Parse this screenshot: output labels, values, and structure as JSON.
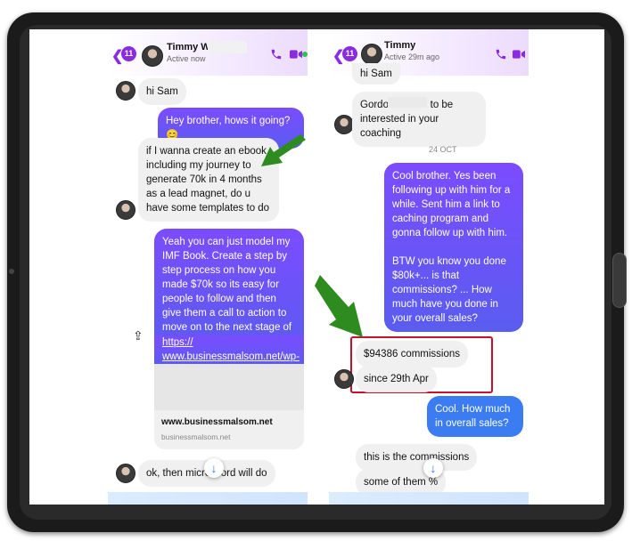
{
  "left_chat": {
    "back_badge": "11",
    "contact_name": "Timmy W",
    "status": "Active now",
    "messages": [
      {
        "dir": "in",
        "text": "hi Sam"
      },
      {
        "dir": "out",
        "text": "Hey brother, hows it going? 😊"
      },
      {
        "dir": "in",
        "text": "if I wanna create an ebook including my journey to generate 70k in 4 months as a lead magnet, do u have some templates to do"
      },
      {
        "dir": "out",
        "text": "Yeah you can just model my IMF Book. Create a step by step process on how you made $70k so its easy for people to follow and then give them a call to action to move on to the next stage of your funnel 😊"
      },
      {
        "dir": "out",
        "text": "https:// www.businessmalsom.net/wp-"
      },
      {
        "dir": "in",
        "text": "ok, then micro word will do"
      }
    ],
    "link_preview": {
      "title": "www.businessmalsom.net",
      "domain": "businessmalsom.net"
    }
  },
  "right_chat": {
    "back_badge": "11",
    "contact_name": "Timmy",
    "status": "Active 29m ago",
    "messages": [
      {
        "dir": "in",
        "text": "hi Sam"
      },
      {
        "dir": "in",
        "text": "Gordon seems to be interested in your coaching"
      },
      {
        "dir": "out",
        "text": "Cool brother. Yes been following up with him for a while. Sent him a link to caching program and gonna follow up with him.\n\nBTW you know you done $80k+... is that commissions? ... How much have you done in your overall sales?"
      },
      {
        "dir": "in",
        "text": "$94386 commissions"
      },
      {
        "dir": "in",
        "text": "since 29th Apr"
      },
      {
        "dir": "out",
        "text": "Cool. How much in overall sales?"
      },
      {
        "dir": "in",
        "text": "this is the commissions"
      },
      {
        "dir": "in",
        "text": "some of them %"
      }
    ],
    "date_divider": "24 OCT"
  },
  "colors": {
    "accent": "#8a2be2",
    "outgoing_top": "#7b4cff",
    "outgoing_bottom": "#5a5cf0",
    "arrow": "#2e8b1f",
    "highlight": "#c8102e"
  }
}
